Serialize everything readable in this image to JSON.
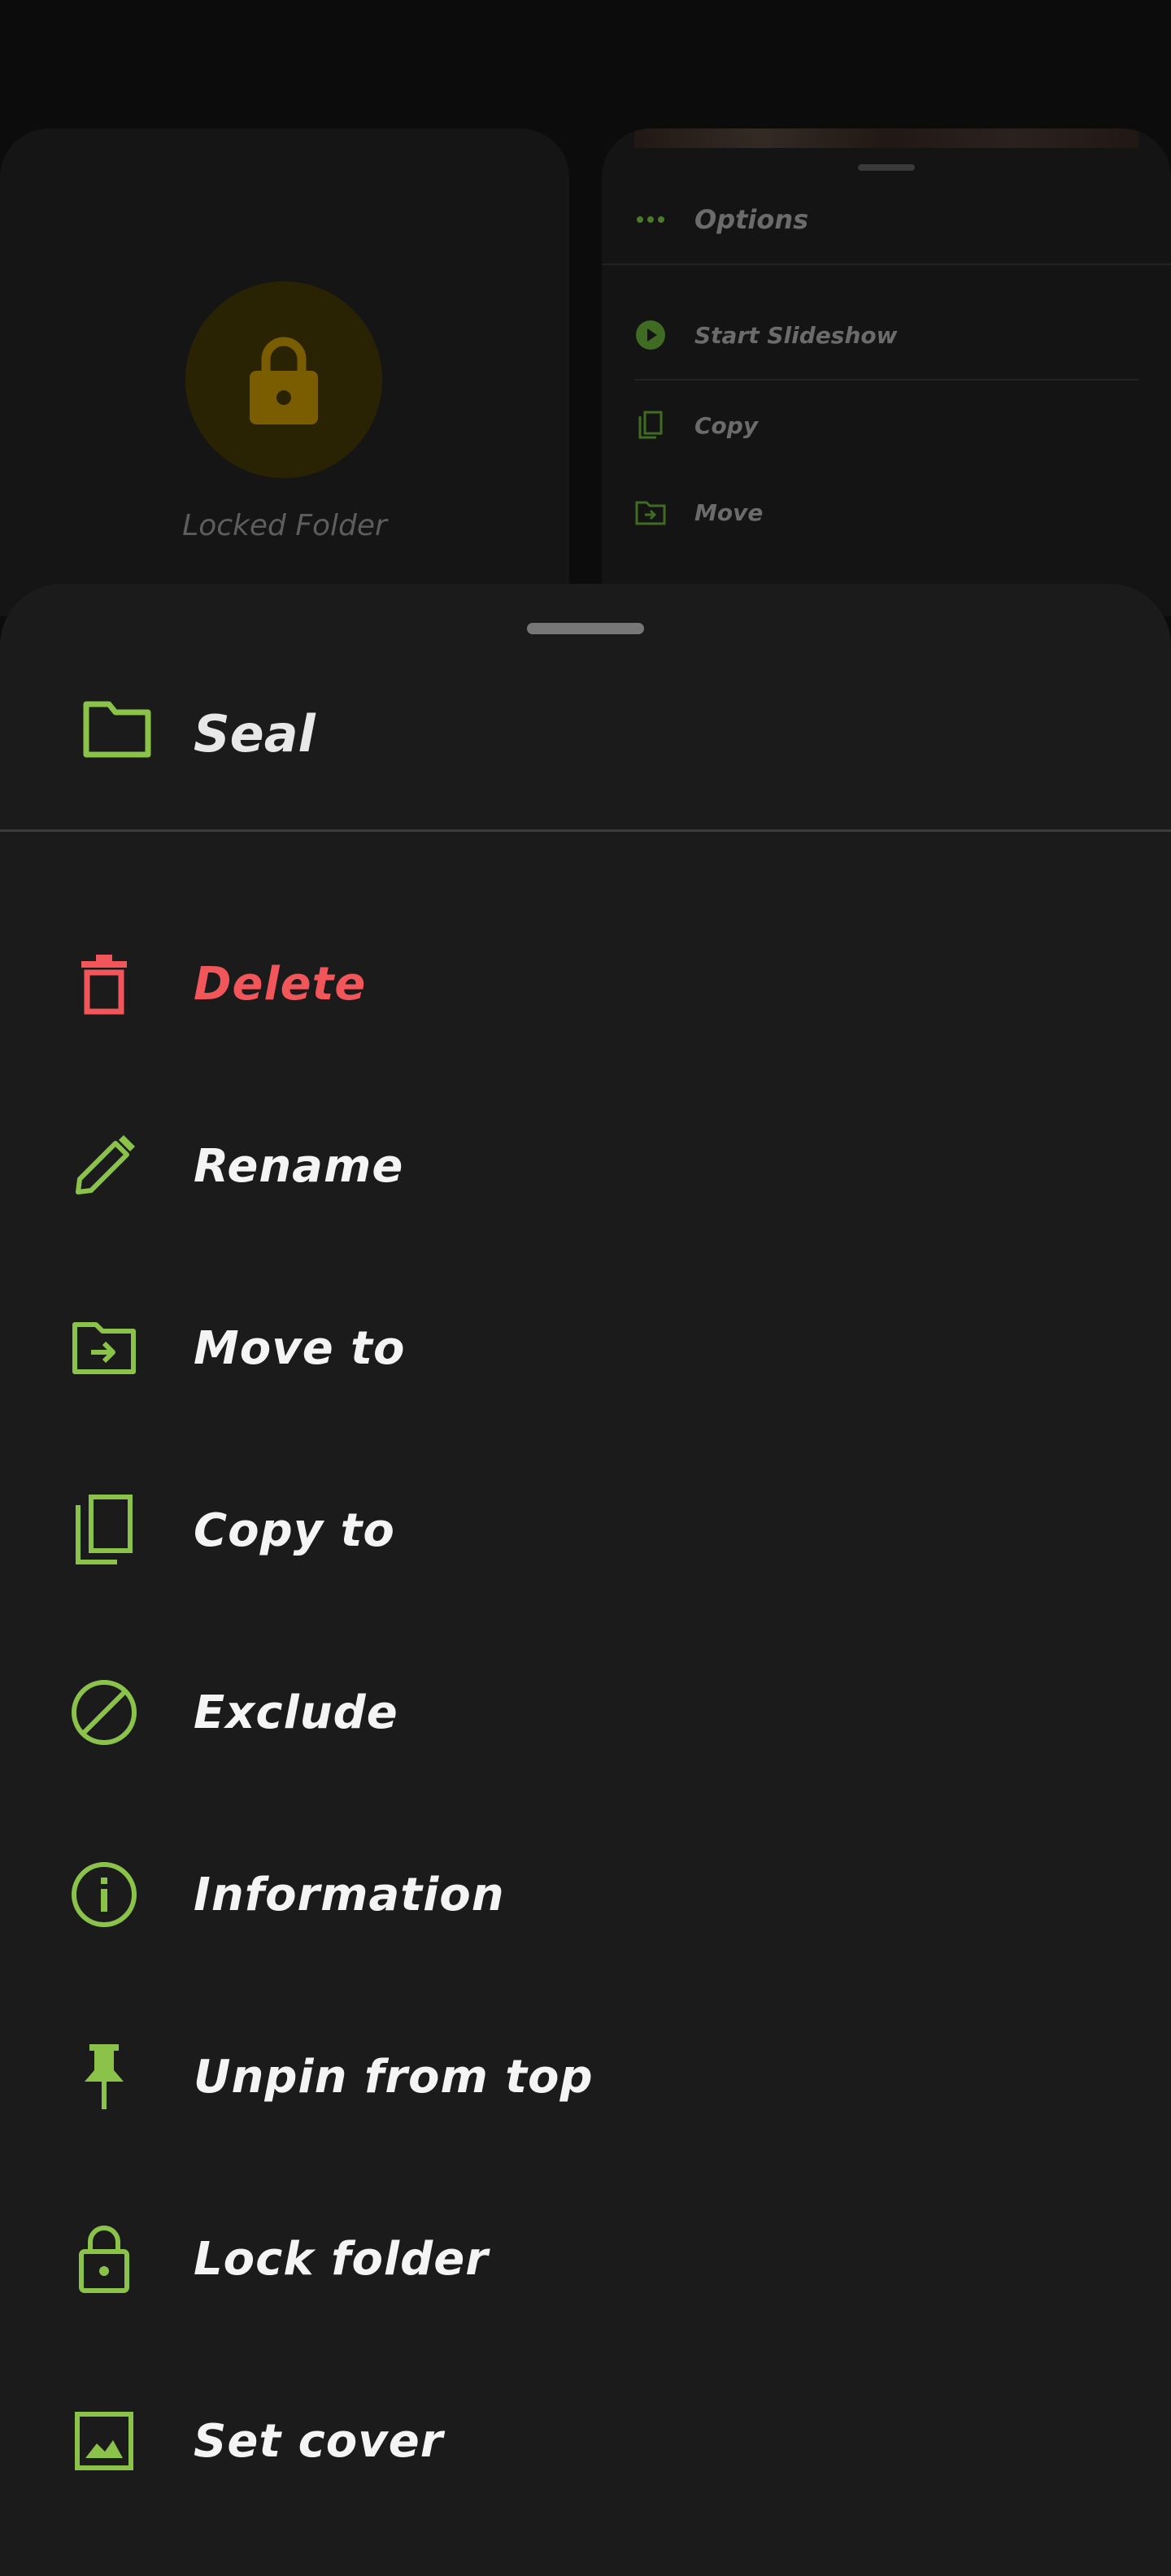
{
  "colors": {
    "accent": "#8bc34a",
    "danger": "#f0565a",
    "sheet_bg": "#1b1b1b",
    "text": "#f4f4f4",
    "lock_yellow": "#7a5d00"
  },
  "background": {
    "locked_folder_label": "Locked Folder",
    "options_panel": {
      "header_icon": "more-horiz-icon",
      "header": "Options",
      "items": [
        {
          "label": "Start Slideshow",
          "icon": "play-circle-icon"
        },
        {
          "label": "Copy",
          "icon": "copy-icon"
        },
        {
          "label": "Move",
          "icon": "move-folder-icon"
        }
      ]
    }
  },
  "sheet": {
    "title": "Seal",
    "title_icon": "folder-icon",
    "items": [
      {
        "label": "Delete",
        "icon": "trash-icon"
      },
      {
        "label": "Rename",
        "icon": "pencil-icon"
      },
      {
        "label": "Move to",
        "icon": "move-folder-icon"
      },
      {
        "label": "Copy to",
        "icon": "copy-icon"
      },
      {
        "label": "Exclude",
        "icon": "block-icon"
      },
      {
        "label": "Information",
        "icon": "info-icon"
      },
      {
        "label": "Unpin from top",
        "icon": "pin-icon"
      },
      {
        "label": "Lock folder",
        "icon": "lock-icon"
      },
      {
        "label": "Set cover",
        "icon": "image-icon"
      }
    ]
  }
}
